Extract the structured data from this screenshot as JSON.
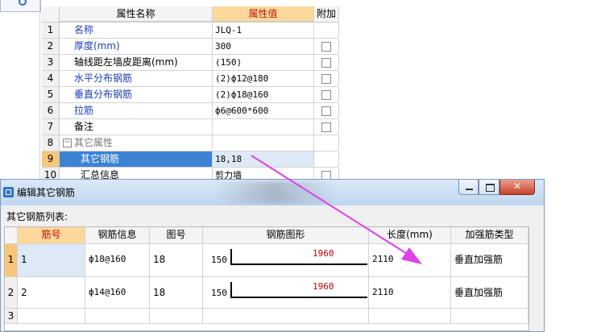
{
  "properties": {
    "headers": {
      "num": "",
      "name": "属性名称",
      "value": "属性值",
      "extra": "附加"
    },
    "rows": [
      {
        "num": "1",
        "name": "名称",
        "value": "JLQ-1",
        "checkbox": false
      },
      {
        "num": "2",
        "name": "厚度(mm)",
        "value": "300",
        "checkbox": true
      },
      {
        "num": "3",
        "name": "轴线距左墙皮距离(mm)",
        "value": "(150)",
        "checkbox": true
      },
      {
        "num": "4",
        "name": "水平分布钢筋",
        "value": "(2)ф12@180",
        "checkbox": true
      },
      {
        "num": "5",
        "name": "垂直分布钢筋",
        "value": "(2)ф18@160",
        "checkbox": true
      },
      {
        "num": "6",
        "name": "拉筋",
        "value": "ф6@600*600",
        "checkbox": true
      },
      {
        "num": "7",
        "name": "备注",
        "value": "",
        "checkbox": true
      },
      {
        "num": "8",
        "name": "其它属性",
        "value": "",
        "checkbox": false
      },
      {
        "num": "9",
        "name": "其它钢筋",
        "value": "18,18",
        "checkbox": false
      },
      {
        "num": "10",
        "name": "汇总信息",
        "value": "剪力墙",
        "checkbox": true
      }
    ]
  },
  "dialog": {
    "title": "编辑其它钢筋",
    "close_glyph": "✕",
    "list_label": "其它钢筋列表:",
    "table": {
      "headers": [
        "筋号",
        "钢筋信息",
        "图号",
        "钢筋图形",
        "长度(mm)",
        "加强筋类型"
      ],
      "rows": [
        {
          "num": "1",
          "bar_no": "1",
          "info": "ф18@160",
          "figure_no": "18",
          "shape_left": "150",
          "shape_value": "1960",
          "length": "2110",
          "type": "垂直加强筋"
        },
        {
          "num": "2",
          "bar_no": "2",
          "info": "ф14@160",
          "figure_no": "18",
          "shape_left": "150",
          "shape_value": "1960",
          "length": "2110",
          "type": "垂直加强筋"
        },
        {
          "num": "3",
          "bar_no": "",
          "info": "",
          "figure_no": "",
          "shape_left": "",
          "shape_value": "",
          "length": "",
          "type": ""
        }
      ]
    }
  },
  "colors": {
    "header_accent": "#fcd89a",
    "header_accent_text": "#c01010",
    "selected_row": "#3c83d6",
    "blue_label": "#1b3fb8",
    "arrow": "#e040e8"
  }
}
